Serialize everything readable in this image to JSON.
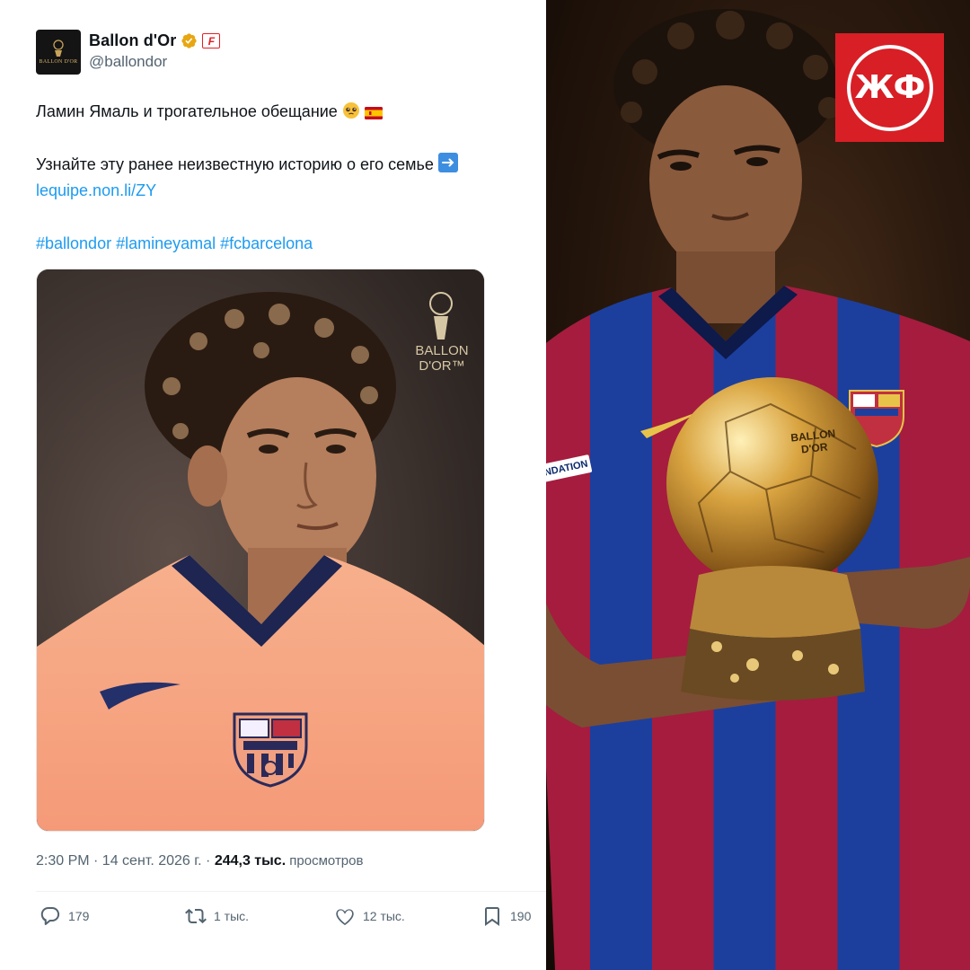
{
  "tweet": {
    "display_name": "Ballon d'Or",
    "handle": "@ballondor",
    "avatar_text": "BALLON D'OR",
    "affiliate_badge": "F",
    "line1": "Ламин Ямаль и трогательное обещание",
    "line2": "Узнайте эту ранее неизвестную историю о его семье",
    "link": "lequipe.non.li/ZY",
    "hashtags": "#ballondor #lamineyamal #fcbarcelona",
    "media_brand": "BALLON D'OR™",
    "timestamp": "2:30 PM · 14 сент. 2026 г. · ",
    "views_count": "244,3 тыс.",
    "views_label": " просмотров"
  },
  "actions": {
    "replies": "179",
    "reposts": "1 тыс.",
    "likes": "12 тыс.",
    "bookmarks": "190"
  },
  "photo": {
    "logo_text": "ЖФ",
    "trophy_label": "BALLON D'OR",
    "sleeve_text": "NDATION"
  },
  "colors": {
    "link": "#1d9bf0",
    "verified": "#e8a611",
    "logo_bg": "#d81f26",
    "barca_blue": "#1c3f9e",
    "barca_red": "#a51c3f"
  },
  "icons": [
    "verified-icon",
    "reply-icon",
    "repost-icon",
    "like-icon",
    "bookmark-icon",
    "arrow-right-icon"
  ]
}
